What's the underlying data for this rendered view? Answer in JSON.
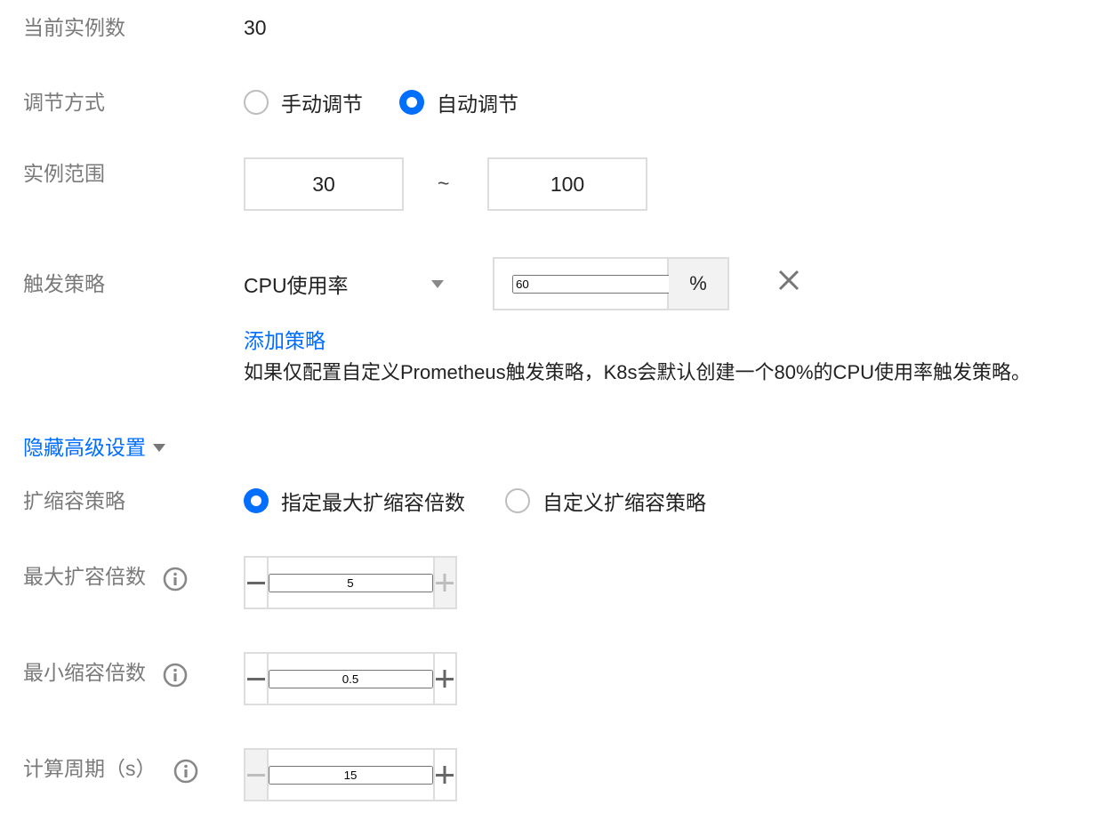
{
  "current_instances": {
    "label": "当前实例数",
    "value": "30"
  },
  "adjust_mode": {
    "label": "调节方式",
    "options": [
      {
        "label": "手动调节",
        "selected": false
      },
      {
        "label": "自动调节",
        "selected": true
      }
    ]
  },
  "instance_range": {
    "label": "实例范围",
    "min": "30",
    "separator": "~",
    "max": "100"
  },
  "trigger_policy": {
    "label": "触发策略",
    "metric": "CPU使用率",
    "threshold": "60",
    "unit": "%",
    "add_link": "添加策略",
    "hint": "如果仅配置自定义Prometheus触发策略，K8s会默认创建一个80%的CPU使用率触发策略。"
  },
  "advanced_toggle": {
    "label": "隐藏高级设置"
  },
  "scale_policy": {
    "label": "扩缩容策略",
    "options": [
      {
        "label": "指定最大扩缩容倍数",
        "selected": true
      },
      {
        "label": "自定义扩缩容策略",
        "selected": false
      }
    ]
  },
  "max_scale_up": {
    "label": "最大扩容倍数",
    "value": "5"
  },
  "min_scale_down": {
    "label": "最小缩容倍数",
    "value": "0.5"
  },
  "calc_period": {
    "label": "计算周期（s）",
    "value": "15"
  },
  "colors": {
    "accent": "#006eff",
    "label": "#7a7a7a",
    "border": "#dddddd",
    "disabled_bg": "#f2f2f2"
  }
}
